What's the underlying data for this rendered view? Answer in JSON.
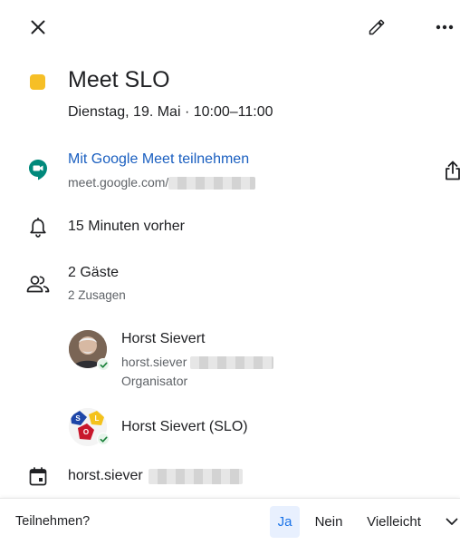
{
  "event": {
    "title": "Meet SLO",
    "color": "#F6BF26",
    "datetime": "Dienstag, 19. Mai · 10:00–11:00"
  },
  "meet": {
    "join_label": "Mit Google Meet teilnehmen",
    "url_prefix": "meet.google.com/"
  },
  "reminder": {
    "label": "15 Minuten vorher"
  },
  "guests": {
    "count_label": "2 Gäste",
    "accepted_label": "2 Zusagen",
    "list": [
      {
        "name": "Horst Sievert",
        "email_prefix": "horst.siever",
        "role": "Organisator"
      },
      {
        "name": "Horst Sievert (SLO)",
        "avatar_letters": [
          "S",
          "L",
          "O"
        ]
      }
    ]
  },
  "calendar": {
    "owner_prefix": "horst.siever"
  },
  "footer": {
    "prompt": "Teilnehmen?",
    "yes": "Ja",
    "no": "Nein",
    "maybe": "Vielleicht"
  },
  "icons": {
    "close": "close-icon",
    "edit": "pencil-icon",
    "more": "more-horiz-icon",
    "meet": "google-meet-icon",
    "share": "share-icon",
    "reminder": "bell-icon",
    "guests": "people-icon",
    "calendar": "calendar-icon",
    "dropdown": "chevron-down-icon"
  },
  "colors": {
    "link": "#1a5fc0",
    "meet_green": "#00897B",
    "selected_bg": "#e8f0fe",
    "selected_text": "#1a73e8",
    "accepted_check": "#188038"
  }
}
